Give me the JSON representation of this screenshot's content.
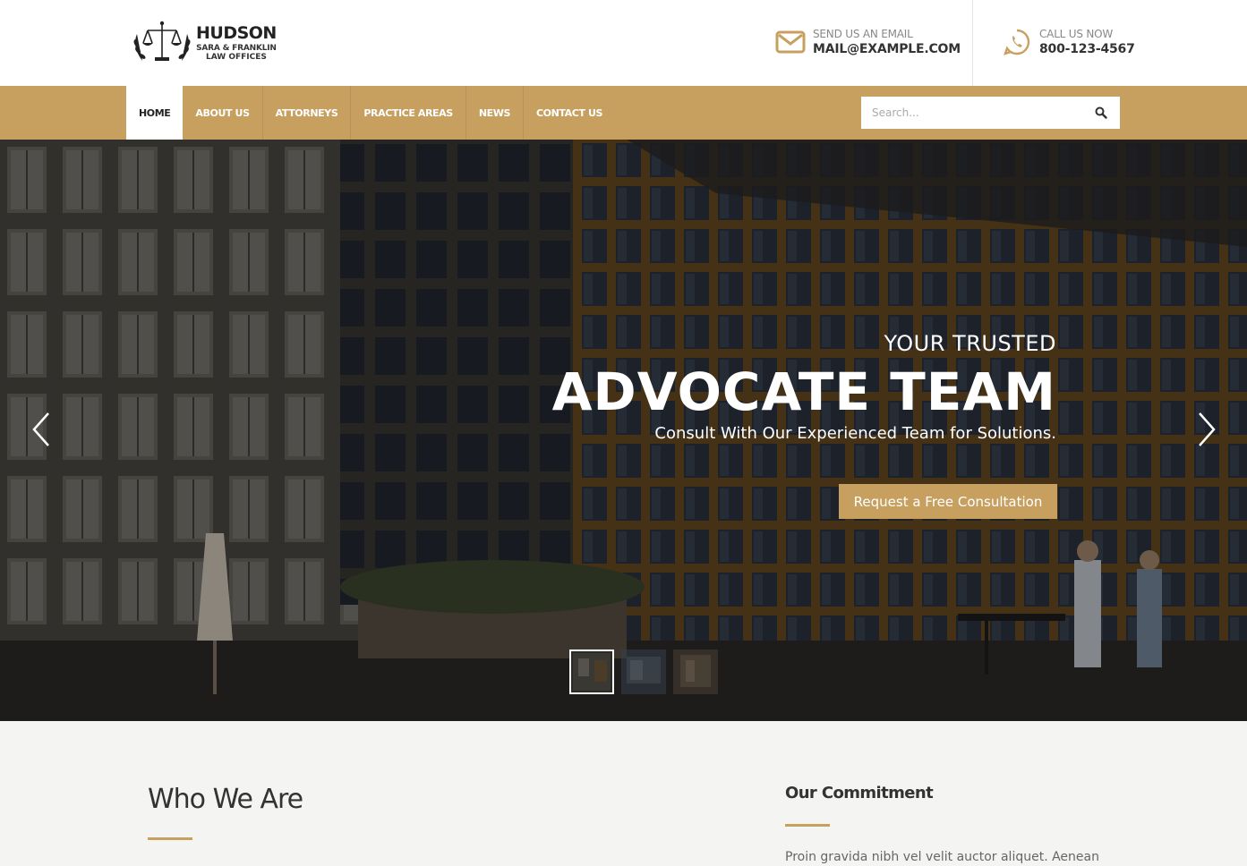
{
  "brand": {
    "name": "HUDSON",
    "tagline_line1": "SARA & FRANKLIN",
    "tagline_line2": "LAW OFFICES"
  },
  "contact": {
    "email_label": "SEND US AN EMAIL",
    "email_value": "MAIL@EXAMPLE.COM",
    "phone_label": "CALL US NOW",
    "phone_value": "800-123-4567"
  },
  "nav": {
    "items": [
      {
        "label": "HOME",
        "active": true
      },
      {
        "label": "ABOUT US"
      },
      {
        "label": "ATTORNEYS"
      },
      {
        "label": "PRACTICE AREAS"
      },
      {
        "label": "NEWS"
      },
      {
        "label": "CONTACT US"
      }
    ],
    "search_placeholder": "Search..."
  },
  "hero": {
    "kicker": "YOUR TRUSTED",
    "title": "ADVOCATE TEAM",
    "subtitle": "Consult With Our Experienced Team for Solutions.",
    "cta": "Request a Free Consultation",
    "slide_count": 3,
    "active_slide": 1
  },
  "sections": {
    "who_title": "Who We Are",
    "commitment_title": "Our Commitment",
    "commitment_text": "Proin gravida nibh vel velit auctor aliquet. Aenean"
  },
  "colors": {
    "accent": "#c7a060",
    "dark_text": "#333333"
  },
  "icons": {
    "email": "envelope-icon",
    "phone": "whatsapp-phone-icon",
    "search": "search-icon",
    "prev": "chevron-left-icon",
    "next": "chevron-right-icon"
  }
}
